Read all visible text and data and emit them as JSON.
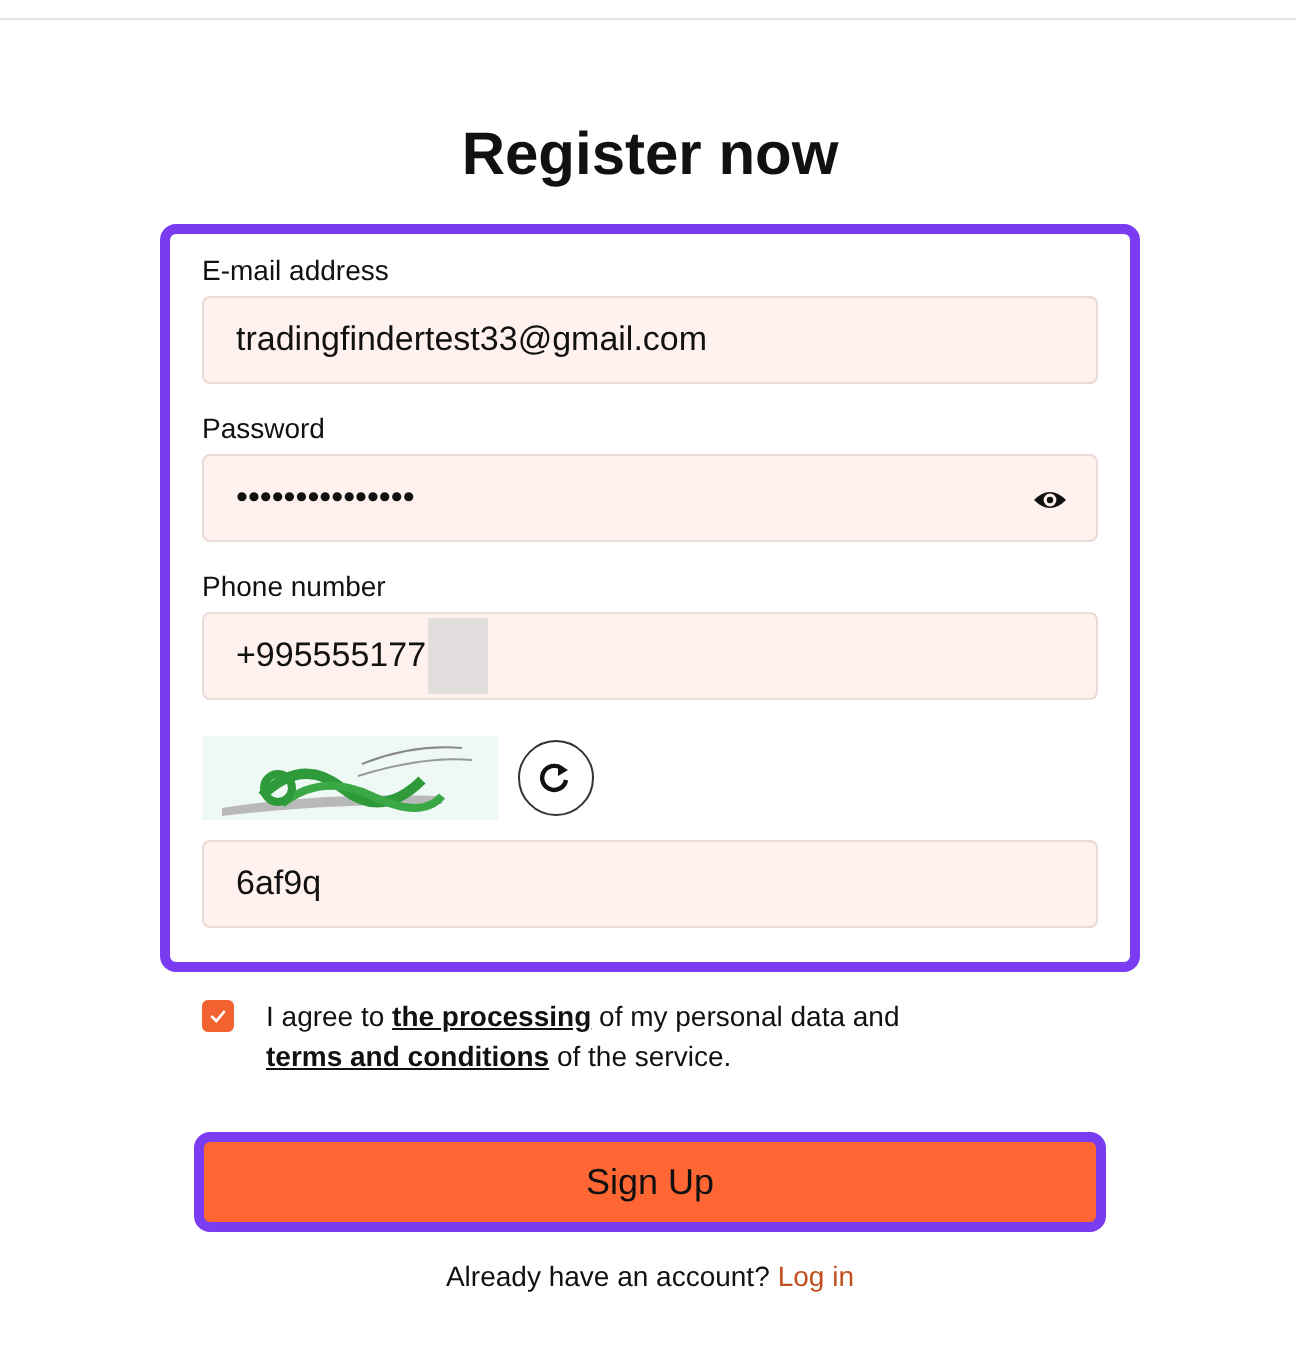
{
  "title": "Register now",
  "fields": [
    {
      "kind": "text",
      "label": "E-mail address",
      "value": "tradingfindertest33@gmail.com"
    },
    {
      "kind": "password",
      "label": "Password",
      "value": "•••••••••••••••"
    },
    {
      "kind": "phone",
      "label": "Phone number",
      "value": "+995555177",
      "redacted": true
    },
    {
      "kind": "captcha",
      "value": "6af9q"
    }
  ],
  "consent": {
    "checked": true,
    "parts": [
      {
        "text": "I agree to ",
        "kind": "text"
      },
      {
        "text": "the processing",
        "kind": "link"
      },
      {
        "text": " of my personal data and ",
        "kind": "text"
      },
      {
        "text": "terms and conditions",
        "kind": "link"
      },
      {
        "text": " of the service.",
        "kind": "text"
      }
    ]
  },
  "submit": "Sign Up",
  "footer": {
    "text": "Already have an account?",
    "link": "Log in"
  }
}
